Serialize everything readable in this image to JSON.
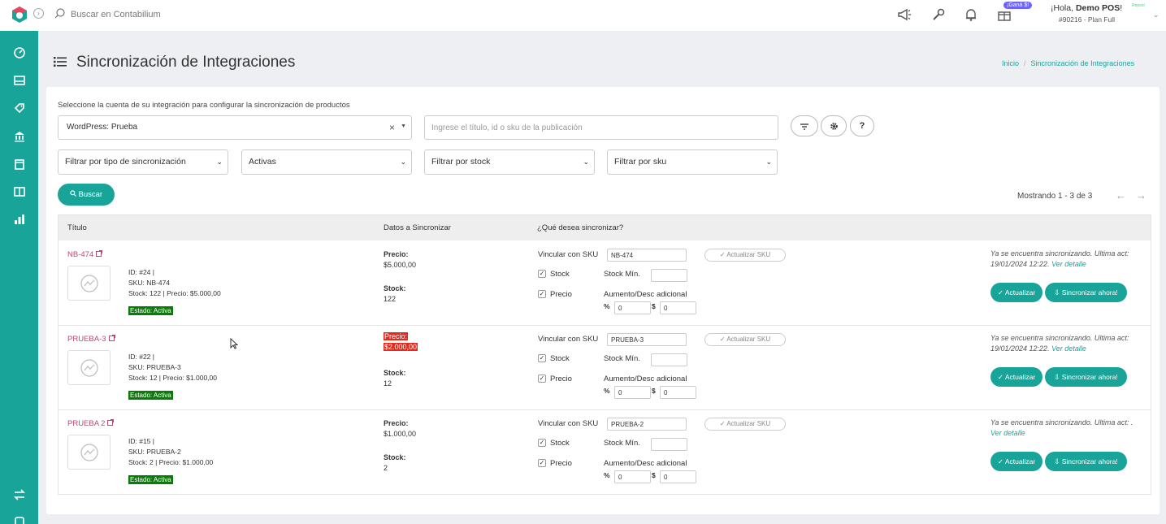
{
  "header": {
    "search_placeholder": "Buscar en Contabilium",
    "badge": "¡Ganá $!",
    "greeting_prefix": "¡Hola, ",
    "greeting_name": "Demo POS",
    "greeting_suffix": "!",
    "account_info": "#90216 - Plan Full",
    "mini_logo_text": "Repsol"
  },
  "page": {
    "title": "Sincronización de Integraciones",
    "breadcrumb": {
      "home": "Inicio",
      "separator": "/",
      "current": "Sincronización de Integraciones"
    }
  },
  "form": {
    "account_label": "Seleccione la cuenta de su integración para configurar la sincronización de productos",
    "account_value": "WordPress: Prueba",
    "clear_symbol": "×",
    "publication_placeholder": "Ingrese el título, id o sku de la publicación",
    "help_label": "?",
    "filters": [
      {
        "value": "Filtrar por tipo de sincronización"
      },
      {
        "value": "Activas"
      },
      {
        "value": "Filtrar por stock"
      },
      {
        "value": "Filtrar por sku"
      }
    ],
    "search_button": "Buscar"
  },
  "pagination": {
    "text": "Mostrando 1 - 3 de 3",
    "prev": "←",
    "next": "→"
  },
  "table": {
    "headers": {
      "title": "Título",
      "sync_data": "Datos a Sincronizar",
      "what_sync": "¿Qué desea sincronizar?"
    },
    "labels": {
      "price": "Precio:",
      "stock": "Stock:",
      "link_sku": "Vincular con SKU",
      "update_sku": "✓ Actualizar SKU",
      "stock_cb": "Stock",
      "price_cb": "Precio",
      "stock_min": "Stock Mín.",
      "adjust": "Aumento/Desc adicional",
      "percent": "%",
      "dollar": "$",
      "update": "✓ Actualizar",
      "sync_now": "⇩ Sincronizar ahora!",
      "check": "✓"
    },
    "rows": [
      {
        "title": "NB-474",
        "id": "ID: #24 |",
        "sku": "SKU: NB-474",
        "stock_price": "Stock: 122 | Precio: $5.000,00",
        "status": "Estado: Activa",
        "price_value": "$5.000,00",
        "stock_value": "122",
        "sku_input": "NB-474",
        "percent": "0",
        "amount": "0",
        "synced_text": "Ya se encuentra sincronizando. Ultima act: 19/01/2024 12:22.",
        "detail_link": "Ver detalle"
      },
      {
        "title": "PRUEBA-3",
        "id": "ID: #22 |",
        "sku": "SKU: PRUEBA-3",
        "stock_price": "Stock: 12 | Precio: $1.000,00",
        "status": "Estado: Activa",
        "price_value": "$2.000,00",
        "stock_value": "12",
        "sku_input": "PRUEBA-3",
        "percent": "0",
        "amount": "0",
        "synced_text": "Ya se encuentra sincronizando. Ultima act: 19/01/2024 12:22.",
        "detail_link": "Ver detalle"
      },
      {
        "title": "PRUEBA 2",
        "id": "ID: #15 |",
        "sku": "SKU: PRUEBA-2",
        "stock_price": "Stock: 2 | Precio: $1.000,00",
        "status": "Estado: Activa",
        "price_value": "$1.000,00",
        "stock_value": "2",
        "sku_input": "PRUEBA-2",
        "percent": "0",
        "amount": "0",
        "synced_text": "Ya se encuentra sincronizando. Ultima act: .",
        "detail_link": "Ver detalle"
      }
    ]
  },
  "colors": {
    "brand": "#19a49a",
    "link": "#b94a6a",
    "status": "#0b7a0b",
    "highlight": "#e02b1e"
  }
}
